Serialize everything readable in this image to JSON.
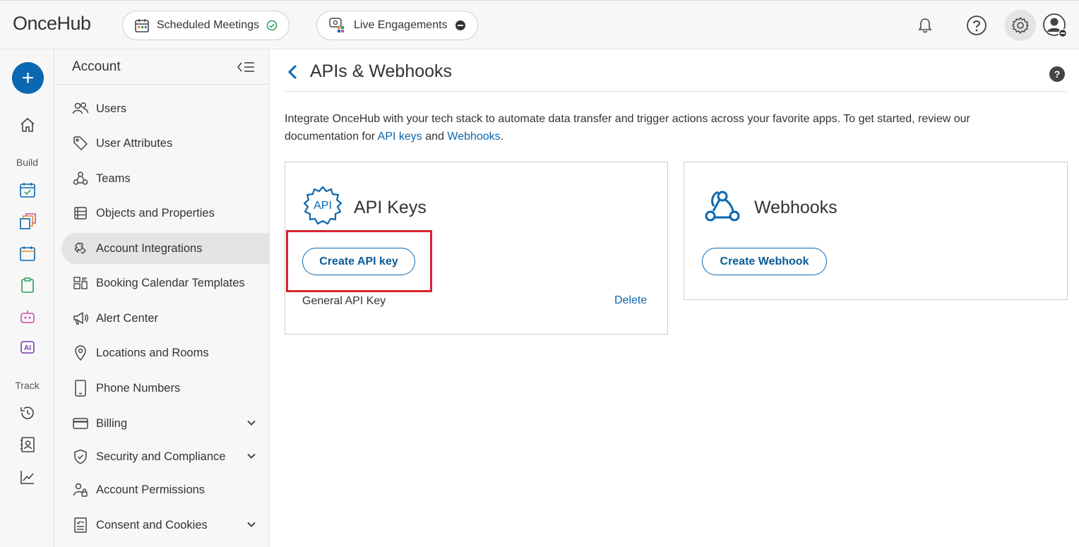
{
  "header": {
    "logo": "OnceHub",
    "scheduled_meetings": "Scheduled Meetings",
    "live_engagements": "Live Engagements"
  },
  "rail": {
    "build_label": "Build",
    "track_label": "Track",
    "ai_badge": "AI"
  },
  "sidebar": {
    "title": "Account",
    "items": [
      {
        "label": "Users",
        "icon": "users-icon"
      },
      {
        "label": "User Attributes",
        "icon": "tag-icon"
      },
      {
        "label": "Teams",
        "icon": "teams-icon"
      },
      {
        "label": "Objects and Properties",
        "icon": "objects-icon"
      },
      {
        "label": "Account Integrations",
        "icon": "puzzle-icon"
      },
      {
        "label": "Booking Calendar Templates",
        "icon": "template-icon"
      },
      {
        "label": "Alert Center",
        "icon": "megaphone-icon"
      },
      {
        "label": "Locations and Rooms",
        "icon": "location-pin-icon"
      },
      {
        "label": "Phone Numbers",
        "icon": "phone-icon"
      },
      {
        "label": "Billing",
        "icon": "credit-card-icon"
      },
      {
        "label": "Security and Compliance",
        "icon": "shield-icon"
      },
      {
        "label": "Account Permissions",
        "icon": "permissions-icon"
      },
      {
        "label": "Consent and Cookies",
        "icon": "consent-icon"
      }
    ]
  },
  "main": {
    "title": "APIs & Webhooks",
    "help": "?",
    "intro_text": "Integrate OnceHub with your tech stack to automate data transfer and trigger actions across your favorite apps. To get started, review our documentation for ",
    "intro_link_api": "API keys",
    "intro_and": " and ",
    "intro_link_webhooks": "Webhooks",
    "intro_end": ".",
    "api_card": {
      "title": "API Keys",
      "icon_text": "API",
      "button": "Create API key",
      "key_name": "General API Key",
      "delete": "Delete"
    },
    "webhook_card": {
      "title": "Webhooks",
      "button": "Create Webhook"
    }
  },
  "colors": {
    "accent": "#0a67b0",
    "highlight": "#d9232f"
  }
}
